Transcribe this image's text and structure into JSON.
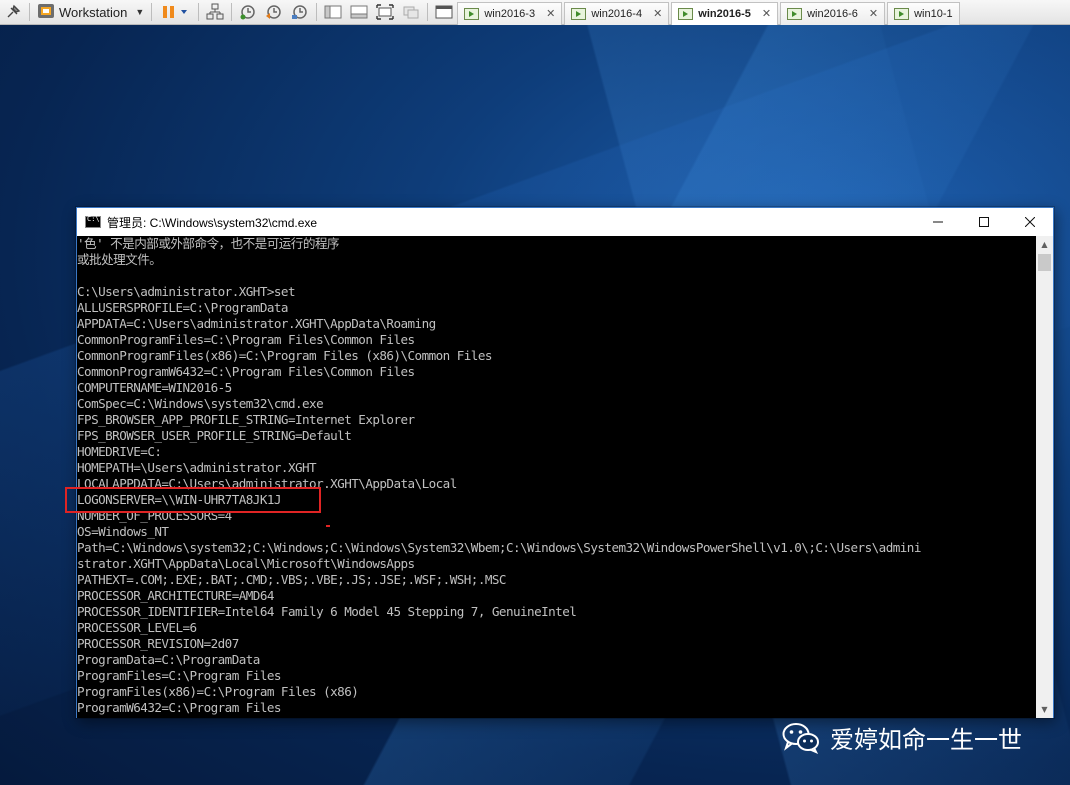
{
  "toolbar": {
    "workstation_label": "Workstation"
  },
  "tabs": [
    {
      "label": "win2016-3",
      "active": false
    },
    {
      "label": "win2016-4",
      "active": false
    },
    {
      "label": "win2016-5",
      "active": true
    },
    {
      "label": "win2016-6",
      "active": false
    },
    {
      "label": "win10-1",
      "active": false
    }
  ],
  "cmd_window": {
    "title": "管理员: C:\\Windows\\system32\\cmd.exe",
    "lines": [
      "'色' 不是内部或外部命令，也不是可运行的程序",
      "或批处理文件。",
      "",
      "C:\\Users\\administrator.XGHT>set",
      "ALLUSERSPROFILE=C:\\ProgramData",
      "APPDATA=C:\\Users\\administrator.XGHT\\AppData\\Roaming",
      "CommonProgramFiles=C:\\Program Files\\Common Files",
      "CommonProgramFiles(x86)=C:\\Program Files (x86)\\Common Files",
      "CommonProgramW6432=C:\\Program Files\\Common Files",
      "COMPUTERNAME=WIN2016-5",
      "ComSpec=C:\\Windows\\system32\\cmd.exe",
      "FPS_BROWSER_APP_PROFILE_STRING=Internet Explorer",
      "FPS_BROWSER_USER_PROFILE_STRING=Default",
      "HOMEDRIVE=C:",
      "HOMEPATH=\\Users\\administrator.XGHT",
      "LOCALAPPDATA=C:\\Users\\administrator.XGHT\\AppData\\Local",
      "LOGONSERVER=\\\\WIN-UHR7TA8JK1J",
      "NUMBER_OF_PROCESSORS=4",
      "OS=Windows_NT",
      "Path=C:\\Windows\\system32;C:\\Windows;C:\\Windows\\System32\\Wbem;C:\\Windows\\System32\\WindowsPowerShell\\v1.0\\;C:\\Users\\admini",
      "strator.XGHT\\AppData\\Local\\Microsoft\\WindowsApps",
      "PATHEXT=.COM;.EXE;.BAT;.CMD;.VBS;.VBE;.JS;.JSE;.WSF;.WSH;.MSC",
      "PROCESSOR_ARCHITECTURE=AMD64",
      "PROCESSOR_IDENTIFIER=Intel64 Family 6 Model 45 Stepping 7, GenuineIntel",
      "PROCESSOR_LEVEL=6",
      "PROCESSOR_REVISION=2d07",
      "ProgramData=C:\\ProgramData",
      "ProgramFiles=C:\\Program Files",
      "ProgramFiles(x86)=C:\\Program Files (x86)",
      "ProgramW6432=C:\\Program Files"
    ]
  },
  "watermark": {
    "text": "爱婷如命一生一世"
  },
  "colors": {
    "highlight": "#e02424",
    "console_text": "#c0c0c0",
    "console_bg": "#000000"
  }
}
